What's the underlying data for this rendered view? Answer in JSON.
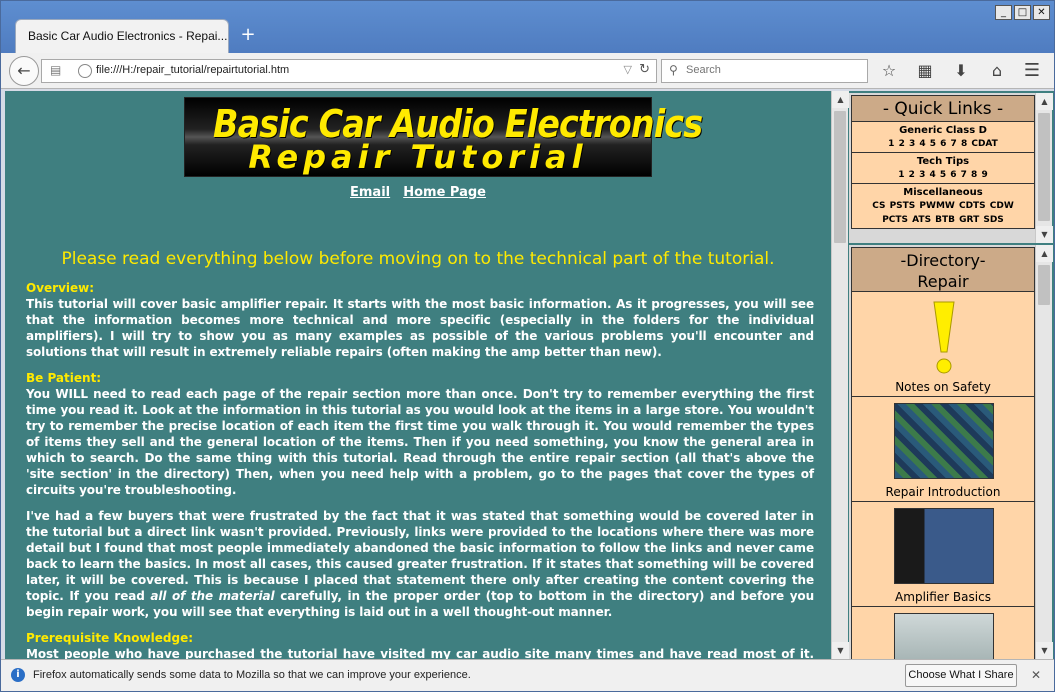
{
  "browser": {
    "tab_title": "Basic Car Audio Electronics - Repai...",
    "new_tab": "+",
    "url": "file:///H:/repair_tutorial/repairtutorial.htm",
    "search_placeholder": "Search",
    "window_buttons": [
      "_",
      "□",
      "✕"
    ]
  },
  "page": {
    "logo_line1": "Basic Car Audio Electronics",
    "logo_line2": "Repair Tutorial",
    "links": [
      "Email",
      "Home Page"
    ],
    "notice": "Please read everything below before moving on to the technical part of the tutorial.",
    "sections": [
      {
        "heading": "Overview:",
        "paragraphs": [
          "This tutorial will cover basic amplifier repair. It starts with the most basic information. As it progresses, you will see that the information becomes more technical and more specific (especially in the folders for the individual amplifiers). I will try to show you as many examples as possible of the various problems you'll encounter and solutions that will result in extremely reliable repairs (often making the amp better than new)."
        ]
      },
      {
        "heading": "Be Patient:",
        "paragraphs": [
          "You WILL need to read each page of the repair section more than once. Don't try to remember everything the first time you read it. Look at the information in this tutorial as you would look at the items in a large store. You wouldn't try to remember the precise location of each item the first time you walk through it. You would remember the types of items they sell and the general location of the items. Then if you need something, you know the general area in which to search. Do the same thing with this tutorial. Read through the entire repair section (all that's above the 'site section' in the directory) Then, when you need help with a problem, go to the pages that cover the types of circuits you're troubleshooting.",
          "I've had a few buyers that were frustrated by the fact that it was stated that something would be covered later in the tutorial but a direct link wasn't provided. Previously, links were provided to the locations where there was more detail but I found that most people immediately abandoned the basic information to follow the links and never came back to learn the basics. In most all cases, this caused greater frustration. If it states that something will be covered later, it will be covered. This is because I placed that statement there only after creating the content covering the topic. If you read",
          "all of the material",
          "carefully, in the proper order (top to bottom in the directory) and before you begin repair work, you will see that everything is laid out in a well thought-out manner."
        ]
      },
      {
        "heading": "Prerequisite Knowledge:",
        "paragraphs": [
          "Most people who have purchased the tutorial have visited my car audio site many times and have read most of it. This"
        ]
      }
    ]
  },
  "quick_links": {
    "title": "- Quick Links -",
    "groups": [
      {
        "heading": "Generic Class D",
        "items": "1 2 3 4 5 6 7 8 CDAT"
      },
      {
        "heading": "Tech Tips",
        "items": "1 2 3 4 5 6 7 8 9"
      },
      {
        "heading": "Miscellaneous",
        "items": "CS PSTS PWMW CDTS CDW",
        "items2": "PCTS ATS BTB GRT SDS"
      }
    ]
  },
  "directory": {
    "title_line1": "-Directory-",
    "title_line2": "Repair",
    "items": [
      {
        "label": "Notes on Safety",
        "icon": "exclamation-icon"
      },
      {
        "label": "Repair Introduction",
        "icon": "circuit-board-photo"
      },
      {
        "label": "Amplifier Basics",
        "icon": "amplifier-photo"
      }
    ]
  },
  "notification": {
    "text": "Firefox automatically sends some data to Mozilla so that we can improve your experience.",
    "button": "Choose What I Share",
    "close": "✕"
  },
  "colors": {
    "page_bg": "#3f7f80",
    "heading_yellow": "#ffea00",
    "sidebar_bg": "#ffd5a8",
    "sidebar_header": "#ccaa88"
  }
}
